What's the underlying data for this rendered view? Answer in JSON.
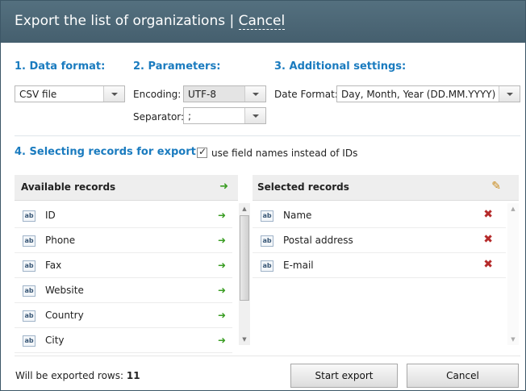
{
  "window": {
    "title": "Export the list of organizations",
    "separator": "|",
    "cancel_link": "Cancel"
  },
  "data_format": {
    "heading": "1. Data format:",
    "selected": "CSV file"
  },
  "parameters": {
    "heading": "2. Parameters:",
    "encoding_label": "Encoding:",
    "encoding_value": "UTF-8",
    "separator_label": "Separator:",
    "separator_value": ";"
  },
  "additional": {
    "heading": "3. Additional settings:",
    "date_format_label": "Date Format:",
    "date_format_value": "Day, Month, Year (DD.MM.YYYY)"
  },
  "selecting": {
    "heading": "4. Selecting records for export:",
    "checkbox_label": "use field names instead of IDs",
    "checkbox_checked": true
  },
  "available": {
    "header": "Available records",
    "items": [
      "ID",
      "Phone",
      "Fax",
      "Website",
      "Country",
      "City"
    ],
    "icon_text": "ab"
  },
  "selected": {
    "header": "Selected records",
    "items": [
      "Name",
      "Postal address",
      "E-mail"
    ],
    "icon_text": "ab"
  },
  "footer": {
    "rows_label": "Will be exported rows:",
    "rows_count": "11",
    "start_button": "Start export",
    "cancel_button": "Cancel"
  },
  "colors": {
    "titlebar": "#4f6a79",
    "heading_blue": "#1a7bbf",
    "add_green": "#3a9d23",
    "remove_red": "#b52a2a"
  },
  "icons": {
    "add_all": "double-green-arrow-icon",
    "add_one": "green-arrow-icon",
    "remove": "red-x-icon",
    "clear": "broom-icon"
  }
}
